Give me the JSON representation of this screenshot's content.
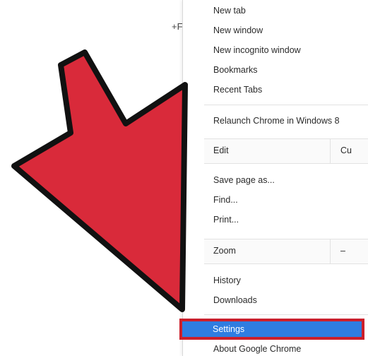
{
  "background": {
    "fragment": "+F"
  },
  "menu": {
    "items": [
      "New tab",
      "New window",
      "New incognito window",
      "Bookmarks",
      "Recent Tabs",
      "Relaunch Chrome in Windows 8",
      "Save page as...",
      "Find...",
      "Print...",
      "History",
      "Downloads",
      "About Google Chrome"
    ],
    "edit_row": {
      "label": "Edit",
      "cut": "Cu"
    },
    "zoom_row": {
      "label": "Zoom",
      "minus": "–"
    },
    "settings": "Settings"
  },
  "colors": {
    "arrow_fill": "#d92a3a",
    "arrow_outline": "#111111",
    "highlight_border": "#cc1f2b",
    "highlight_fill": "#2f7de1"
  },
  "icons": {
    "pointer": "red-arrow-icon"
  }
}
